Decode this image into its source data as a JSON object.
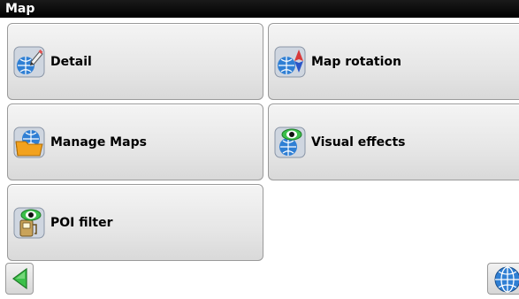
{
  "title": "Map",
  "tiles": [
    {
      "label": "Detail",
      "icon": "detail-icon"
    },
    {
      "label": "Map rotation",
      "icon": "map-rotation-icon"
    },
    {
      "label": "Manage Maps",
      "icon": "manage-maps-icon"
    },
    {
      "label": "Visual effects",
      "icon": "visual-effects-icon"
    },
    {
      "label": "POI filter",
      "icon": "poi-filter-icon"
    }
  ],
  "footer": {
    "back_icon": "back-arrow-icon",
    "globe_icon": "globe-icon"
  },
  "colors": {
    "titlebar": "#000000",
    "tile_bg": "#e6e6e6",
    "tile_border": "#9a9a9a",
    "accent_green": "#3cc04a",
    "accent_blue": "#2f7fd4"
  }
}
